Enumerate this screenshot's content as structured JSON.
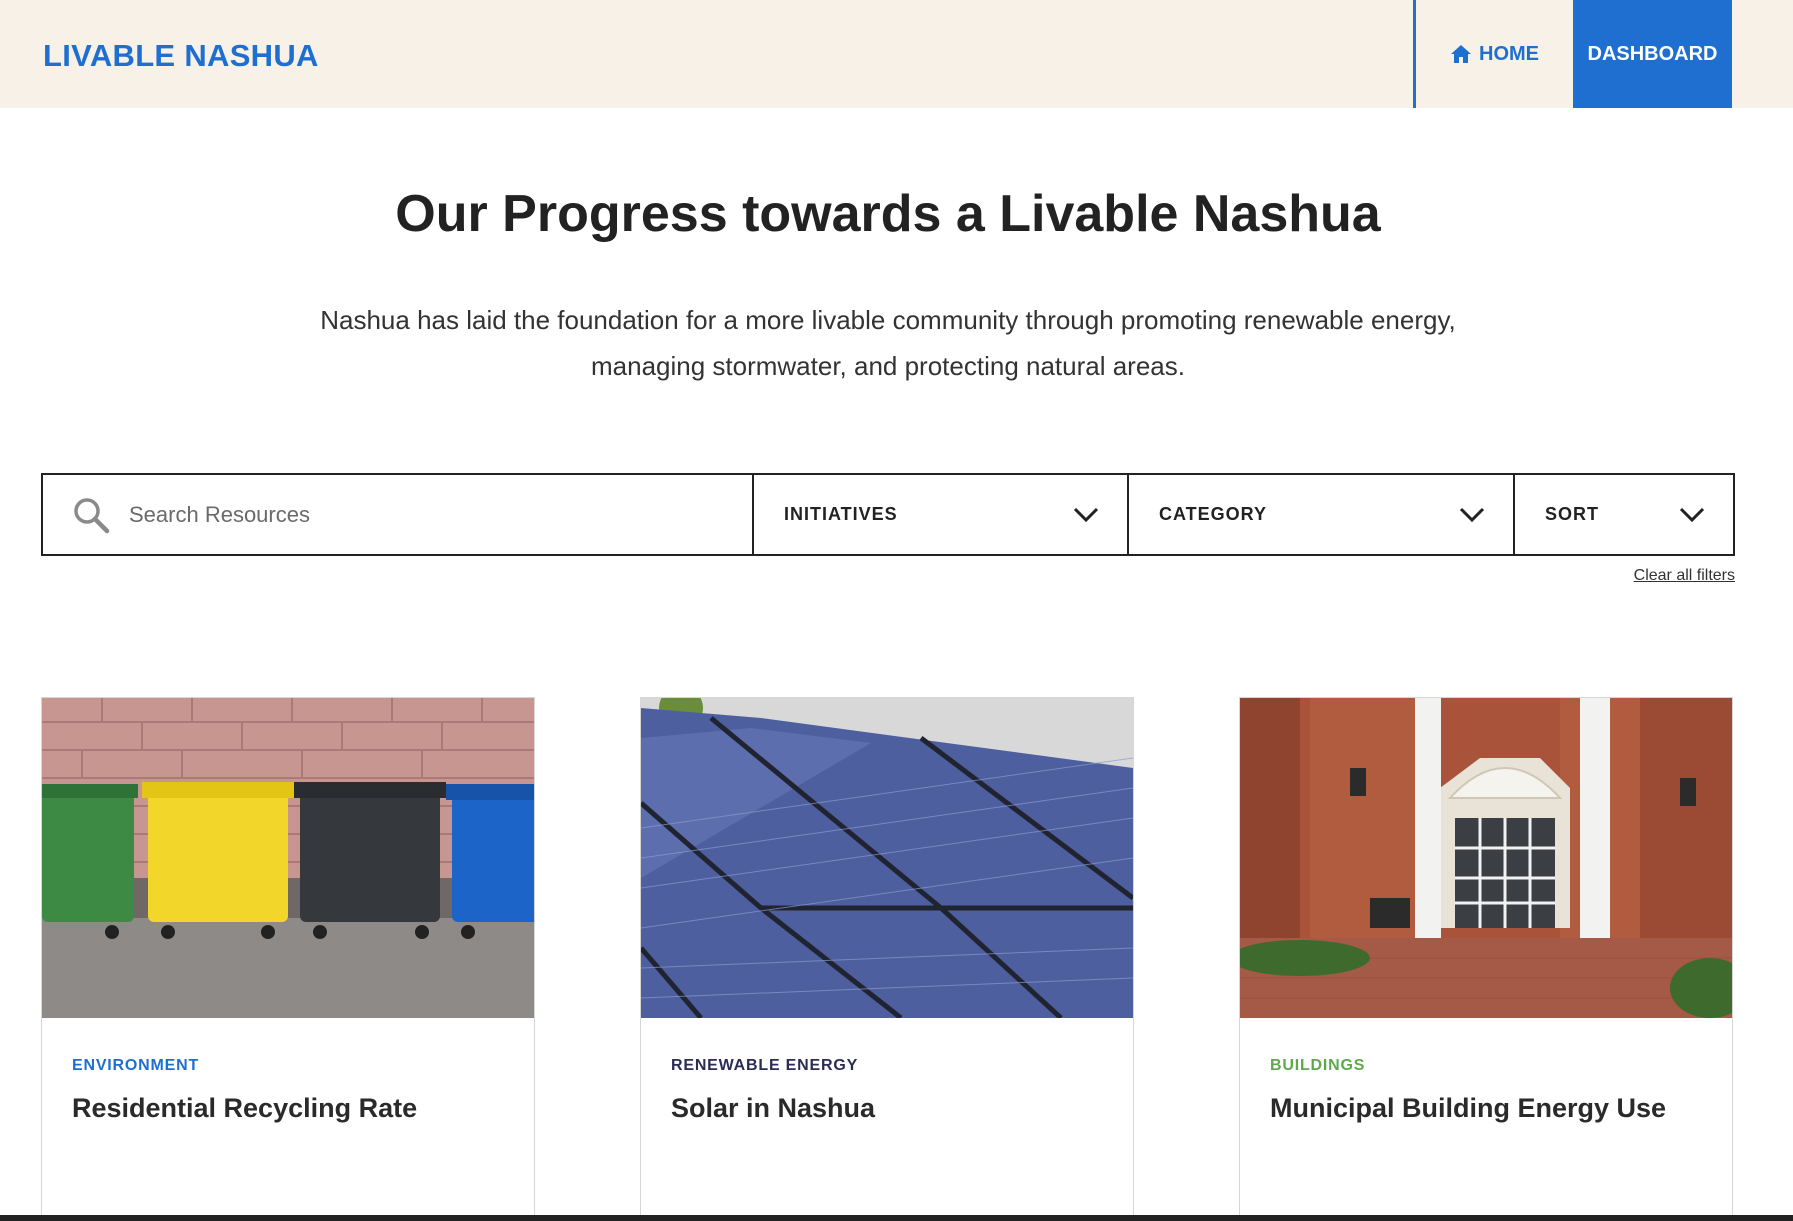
{
  "header": {
    "brand": "LIVABLE NASHUA",
    "nav": {
      "home_label": "HOME",
      "dashboard_label": "DASHBOARD"
    },
    "colors": {
      "accent": "#1f6fd1",
      "background": "#f7f1e8"
    }
  },
  "main": {
    "title": "Our Progress towards a Livable Nashua",
    "intro": "Nashua has laid the foundation for a more livable community through promoting renewable energy, managing stormwater, and protecting natural areas."
  },
  "filters": {
    "search_placeholder": "Search Resources",
    "initiatives_label": "INITIATIVES",
    "category_label": "CATEGORY",
    "sort_label": "SORT",
    "clear_label": "Clear all filters",
    "icons": {
      "search": "search-icon",
      "dropdown": "chevron-down-icon"
    }
  },
  "cards": [
    {
      "category": "ENVIRONMENT",
      "category_color": "#1f6fd1",
      "title": "Residential Recycling Rate",
      "image": "recycling-bins-image"
    },
    {
      "category": "RENEWABLE ENERGY",
      "category_color": "#2b2d55",
      "title": "Solar in Nashua",
      "image": "solar-panels-image"
    },
    {
      "category": "BUILDINGS",
      "category_color": "#5ea94e",
      "title": "Municipal Building Energy Use",
      "image": "municipal-building-image"
    }
  ]
}
